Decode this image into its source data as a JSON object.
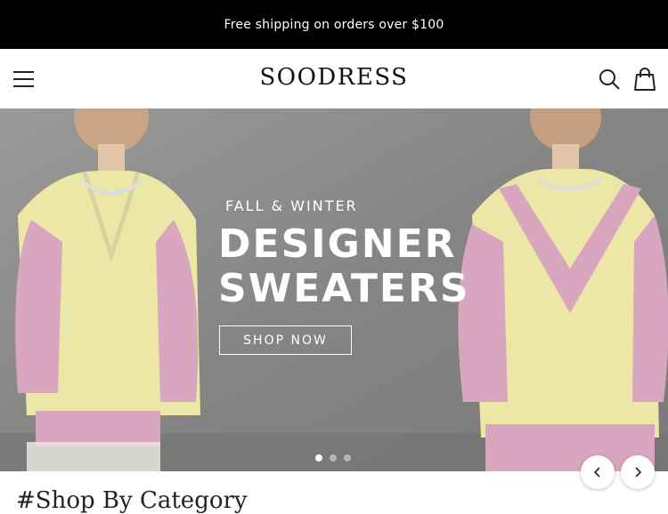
{
  "announcement": {
    "text": "Free shipping on orders over $100"
  },
  "header": {
    "logo": "SOODRESS",
    "icons": {
      "menu": "hamburger-menu-icon",
      "search": "search-icon",
      "cart": "shopping-bag-icon"
    }
  },
  "hero": {
    "eyebrow": "FALL & WINTER",
    "title_line1": "DESIGNER",
    "title_line2": "SWEATERS",
    "cta_label": "SHOP NOW",
    "slides_count": 3,
    "active_slide": 1
  },
  "carousel": {
    "prev_icon": "chevron-left-icon",
    "next_icon": "chevron-right-icon"
  },
  "section": {
    "title": "#Shop By Category"
  },
  "colors": {
    "announcement_bg": "#000000",
    "text_light": "#ffffff",
    "sweater_yellow": "#ece7a6",
    "sweater_pink": "#d9a6c0"
  }
}
